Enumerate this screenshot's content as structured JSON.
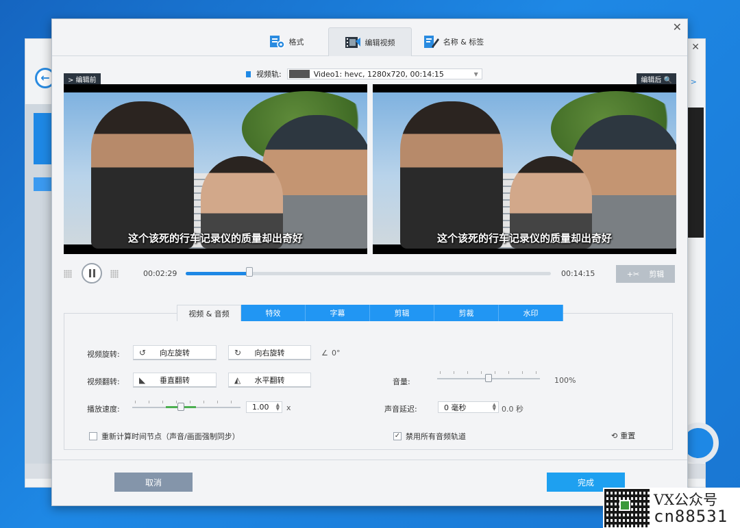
{
  "dialog": {
    "tabs": [
      {
        "label": "格式",
        "icon": "format-settings-icon"
      },
      {
        "label": "编辑视频",
        "icon": "film-edit-icon"
      },
      {
        "label": "名称 & 标签",
        "icon": "tag-edit-icon"
      }
    ],
    "active_tab": 1,
    "close_glyph": "✕"
  },
  "preview": {
    "before_label": "> 编辑前",
    "after_label": "编辑后 🔍",
    "track_label": "视频轨:",
    "track_value": "Video1: hevc, 1280x720, 00:14:15",
    "subtitle": "这个该死的行车记录仪的质量却出奇好"
  },
  "player": {
    "current_time": "00:02:29",
    "total_time": "00:14:15",
    "progress": 0.174,
    "cut_label": "剪辑"
  },
  "edit_tabs": [
    "视频 & 音频",
    "特效",
    "字幕",
    "剪辑",
    "剪裁",
    "水印"
  ],
  "controls": {
    "rotate_label": "视频旋转:",
    "rotate_left": "向左旋转",
    "rotate_right": "向右旋转",
    "angle": "0°",
    "flip_label": "视频翻转:",
    "flip_vertical": "垂直翻转",
    "flip_horizontal": "水平翻转",
    "speed_label": "播放速度:",
    "speed_value": "1.00",
    "speed_unit": "x",
    "speed_level": 0.45,
    "volume_label": "音量:",
    "volume_value": "100%",
    "volume_level": 0.5,
    "delay_label": "声音延迟:",
    "delay_value": "0 毫秒",
    "delay_seconds": "0.0 秒",
    "recalc_label": "重新计算时间节点（声音/画面强制同步）",
    "recalc_checked": false,
    "disable_audio_label": "禁用所有音频轨道",
    "disable_audio_checked": true,
    "reset_label": "重置"
  },
  "footer": {
    "cancel": "取消",
    "done": "完成"
  },
  "background_window": {
    "close_glyph": "✕",
    "link_fragment": "s >"
  },
  "watermark": {
    "line1": "VX公众号",
    "line2": "cn88531"
  },
  "colors": {
    "accent": "#1e88e5",
    "tab_blue": "#2196f3",
    "done": "#1ea0f0",
    "cancel": "#8495aa"
  }
}
